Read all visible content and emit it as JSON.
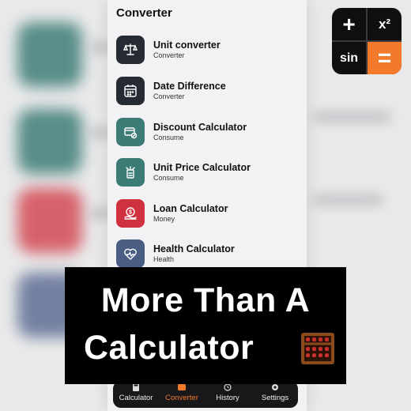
{
  "header": {
    "title": "Converter"
  },
  "items": [
    {
      "title": "Unit converter",
      "subtitle": "Converter",
      "icon": "scale-icon",
      "color": "#252a33"
    },
    {
      "title": "Date Difference",
      "subtitle": "Converter",
      "icon": "calendar-icon",
      "color": "#252a33"
    },
    {
      "title": "Discount Calculator",
      "subtitle": "Consume",
      "icon": "tag-icon",
      "color": "#3d7b77"
    },
    {
      "title": "Unit Price Calculator",
      "subtitle": "Consume",
      "icon": "price-icon",
      "color": "#3d7b77"
    },
    {
      "title": "Loan Calculator",
      "subtitle": "Money",
      "icon": "money-icon",
      "color": "#d0313f"
    },
    {
      "title": "Health Calculator",
      "subtitle": "Health",
      "icon": "heart-icon",
      "color": "#4a5d82"
    }
  ],
  "nav": [
    {
      "label": "Calculator",
      "icon": "calculator-icon"
    },
    {
      "label": "Converter",
      "icon": "converter-icon"
    },
    {
      "label": "History",
      "icon": "history-icon"
    },
    {
      "label": "Settings",
      "icon": "settings-icon"
    }
  ],
  "active_nav": "Converter",
  "caption": {
    "line1": "More Than A",
    "line2": "Calculator"
  },
  "logo": {
    "plus": "+",
    "square": "x²",
    "sin": "sin",
    "equals": "="
  },
  "colors": {
    "accent": "#f37a2b",
    "dark": "#252a33",
    "teal": "#3d7b77",
    "red": "#d0313f",
    "slate": "#4a5d82"
  }
}
